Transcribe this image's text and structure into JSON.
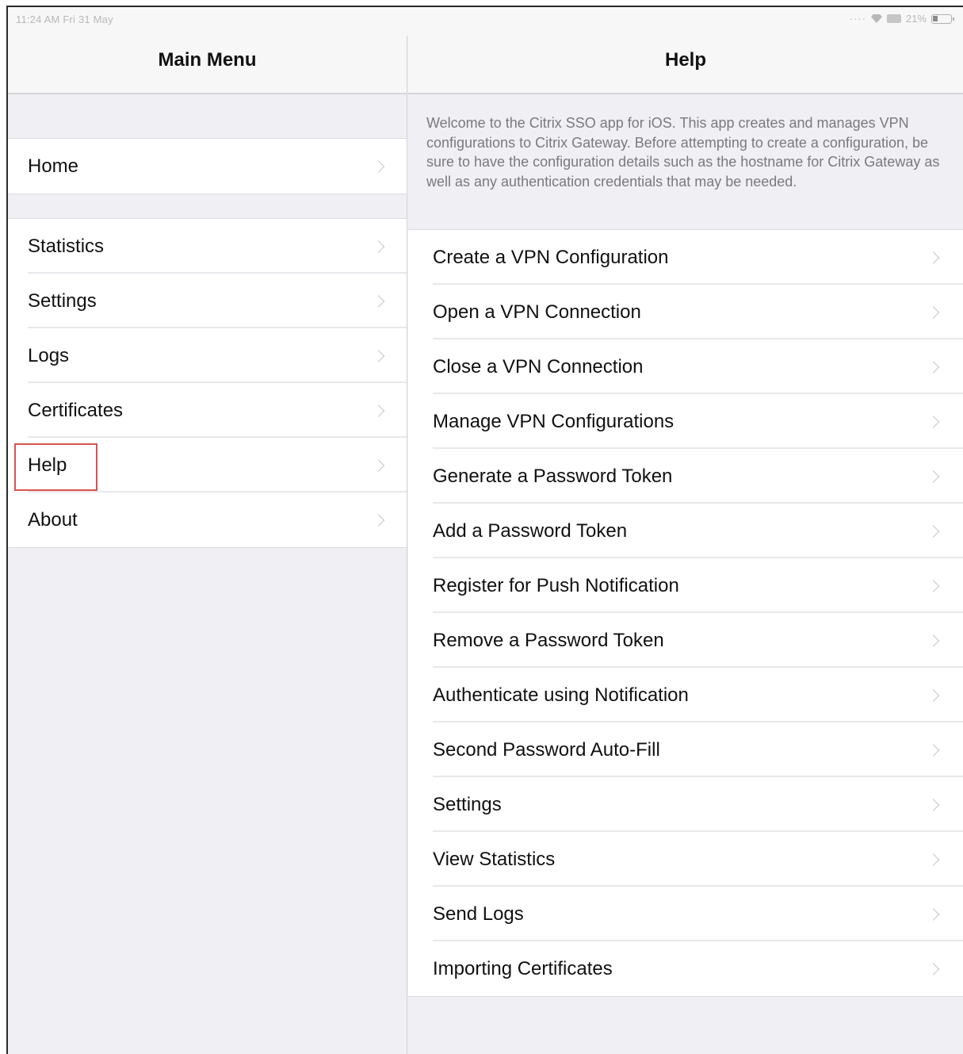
{
  "status_bar": {
    "time": "11:24 AM  Fri 31 May",
    "battery": "21%"
  },
  "left_pane": {
    "title": "Main Menu",
    "group1": [
      {
        "label": "Home"
      }
    ],
    "group2": [
      {
        "label": "Statistics"
      },
      {
        "label": "Settings"
      },
      {
        "label": "Logs"
      },
      {
        "label": "Certificates"
      },
      {
        "label": "Help",
        "highlighted": true
      },
      {
        "label": "About"
      }
    ]
  },
  "right_pane": {
    "title": "Help",
    "intro": "Welcome to the Citrix SSO app for iOS. This app creates and manages VPN configurations to Citrix Gateway. Before attempting to create a configuration, be sure to have the configuration details such as the hostname for Citrix Gateway as well as any authentication credentials that may be needed.",
    "topics": [
      {
        "label": "Create a VPN Configuration"
      },
      {
        "label": "Open a VPN Connection"
      },
      {
        "label": "Close a VPN Connection"
      },
      {
        "label": "Manage VPN Configurations"
      },
      {
        "label": "Generate a Password Token"
      },
      {
        "label": "Add a Password Token"
      },
      {
        "label": "Register for Push Notification"
      },
      {
        "label": "Remove a Password Token"
      },
      {
        "label": "Authenticate using Notification"
      },
      {
        "label": "Second Password Auto-Fill"
      },
      {
        "label": "Settings"
      },
      {
        "label": "View Statistics"
      },
      {
        "label": "Send Logs"
      },
      {
        "label": "Importing Certificates"
      }
    ]
  },
  "colors": {
    "background": "#efeff4",
    "highlight_border": "#d9534f",
    "chevron": "#c4c4c8"
  }
}
